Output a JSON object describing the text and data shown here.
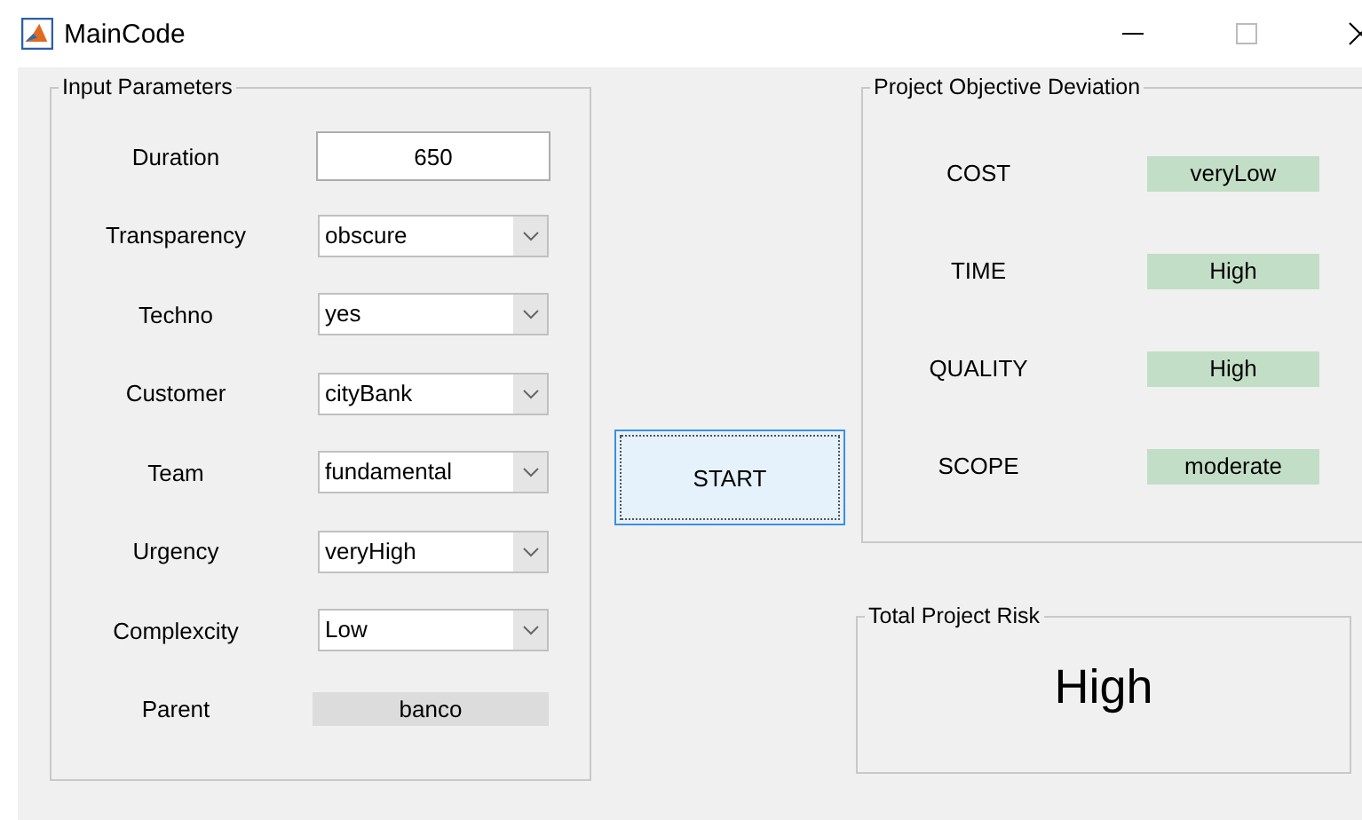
{
  "window": {
    "title": "MainCode"
  },
  "input_parameters": {
    "title": "Input Parameters",
    "fields": [
      {
        "label": "Duration",
        "kind": "text",
        "value": "650"
      },
      {
        "label": "Transparency",
        "kind": "dropdown",
        "value": "obscure"
      },
      {
        "label": "Techno",
        "kind": "dropdown",
        "value": "yes"
      },
      {
        "label": "Customer",
        "kind": "dropdown",
        "value": "cityBank"
      },
      {
        "label": "Team",
        "kind": "dropdown",
        "value": "fundamental"
      },
      {
        "label": "Urgency",
        "kind": "dropdown",
        "value": "veryHigh"
      },
      {
        "label": "Complexcity",
        "kind": "dropdown",
        "value": "Low"
      },
      {
        "label": "Parent",
        "kind": "readonly",
        "value": "banco"
      }
    ]
  },
  "start_button": {
    "label": "START"
  },
  "objective_deviation": {
    "title": "Project Objective Deviation",
    "items": [
      {
        "label": "COST",
        "value": "veryLow"
      },
      {
        "label": "TIME",
        "value": "High"
      },
      {
        "label": "QUALITY",
        "value": "High"
      },
      {
        "label": "SCOPE",
        "value": "moderate"
      }
    ]
  },
  "total_risk": {
    "title": "Total Project Risk",
    "value": "High"
  }
}
